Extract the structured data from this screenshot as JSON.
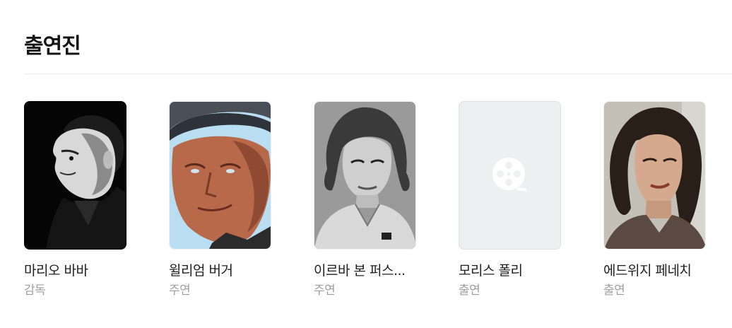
{
  "section": {
    "title": "출연진"
  },
  "cast": [
    {
      "name": "마리오 바바",
      "role": "감독",
      "photo": "bw-portrait-man-profile"
    },
    {
      "name": "윌리엄 버거",
      "role": "주연",
      "photo": "color-portrait-man-hat"
    },
    {
      "name": "이르바 본 퍼스...",
      "role": "주연",
      "photo": "bw-portrait-woman"
    },
    {
      "name": "모리스 폴리",
      "role": "출연",
      "photo": "film-reel-icon"
    },
    {
      "name": "에드위지 페네치",
      "role": "출연",
      "photo": "color-portrait-woman"
    }
  ],
  "colors": {
    "title": "#141414",
    "name": "#1f1f1f",
    "role": "#9e9e9e",
    "divider": "#ececec",
    "placeholder_bg": "#eeeff1"
  }
}
